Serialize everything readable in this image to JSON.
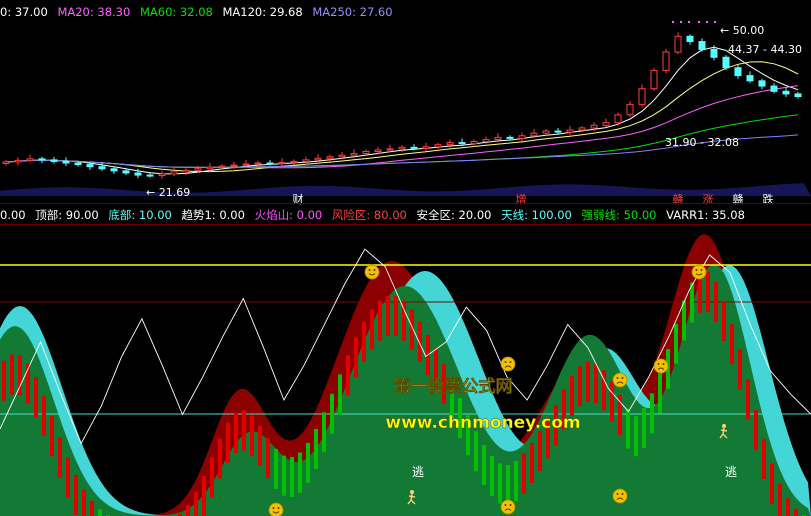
{
  "colors": {
    "bg": "#000000",
    "up_candle": "#ff3c3c",
    "down_candle": "#54ffff",
    "ma_white": "#ffffff",
    "ma20": "#ff60ff",
    "ma60": "#00e000",
    "ma120": "#e0e0e0",
    "ma250": "#8080ff",
    "volume_base": "#5050ff",
    "band_darkred": "#8b0000",
    "band_green": "#137a36",
    "band_cyan": "#44d6d6",
    "line_yellow": "#ffff00",
    "line_darkred": "#8b0000",
    "line_cyan": "#40e0d0",
    "bar_red": "#e00000",
    "bar_green": "#00c000",
    "watermark": "#ffff00"
  },
  "top_header": [
    {
      "text": "0: 37.00",
      "color": "#ffffff"
    },
    {
      "text": "MA20: 38.30",
      "color": "#ff60ff"
    },
    {
      "text": "MA60: 32.08",
      "color": "#00e000"
    },
    {
      "text": "MA120: 29.68",
      "color": "#ffffff"
    },
    {
      "text": "MA250: 27.60",
      "color": "#9090ff"
    }
  ],
  "indicator_header": [
    {
      "text": "0.00",
      "color": "#ffffff"
    },
    {
      "text": "顶部: 90.00",
      "color": "#ffffff"
    },
    {
      "text": "底部: 10.00",
      "color": "#54ffff"
    },
    {
      "text": "趋势1: 0.00",
      "color": "#ffffff"
    },
    {
      "text": "火焰山: 0.00",
      "color": "#ff50ff"
    },
    {
      "text": "风险区: 80.00",
      "color": "#ff4040"
    },
    {
      "text": "安全区: 20.00",
      "color": "#ffffff"
    },
    {
      "text": "天线: 100.00",
      "color": "#54ffff"
    },
    {
      "text": "强弱线: 50.00",
      "color": "#00e000"
    },
    {
      "text": "VARR1: 35.08",
      "color": "#ffffff"
    }
  ],
  "price_annotations": {
    "high": "50.00",
    "range": "44.37 - 44.30",
    "mid": "31.90 - 32.08",
    "low": "21.69"
  },
  "event_labels": [
    "财",
    "增",
    "赣",
    "涨",
    "赣",
    "跌"
  ],
  "signal_labels": [
    "逃",
    "逃"
  ],
  "watermark": {
    "title": "第一股票公式网",
    "url": "www.chnmoney.com"
  },
  "icons": [
    "smile-face-icon",
    "sad-face-icon",
    "runner-icon"
  ],
  "chart_data": [
    {
      "type": "candlestick",
      "title": "",
      "series": [
        {
          "name": "MA20",
          "value": 38.3
        },
        {
          "name": "MA60",
          "value": 32.08
        },
        {
          "name": "MA120",
          "value": 29.68
        },
        {
          "name": "MA250",
          "value": 27.6
        }
      ],
      "close": [
        24.5,
        24.8,
        25.1,
        24.9,
        24.6,
        24.3,
        24.0,
        23.6,
        23.2,
        22.8,
        22.4,
        22.0,
        21.9,
        22.2,
        22.6,
        22.9,
        23.2,
        23.5,
        23.7,
        23.9,
        24.1,
        24.3,
        24.2,
        24.4,
        24.6,
        24.9,
        25.2,
        25.5,
        25.8,
        26.1,
        26.5,
        26.8,
        27.0,
        27.3,
        27.1,
        27.4,
        27.8,
        28.2,
        28.0,
        28.4,
        28.8,
        29.2,
        29.0,
        29.5,
        30.0,
        30.4,
        30.2,
        30.6,
        31.0,
        31.5,
        32.0,
        33.5,
        35.5,
        38.5,
        42.0,
        45.5,
        48.5,
        47.5,
        46.0,
        44.5,
        42.5,
        41.0,
        40.0,
        39.0,
        38.0,
        37.5,
        37.0
      ],
      "ylim": [
        18,
        52
      ]
    },
    {
      "type": "line",
      "title": "",
      "ylim": [
        0,
        100
      ],
      "reference_lines": [
        90,
        80,
        20,
        10
      ],
      "series": [
        {
          "name": "VARR1",
          "values": [
            30,
            45,
            60,
            42,
            25,
            38,
            55,
            68,
            52,
            35,
            48,
            62,
            75,
            58,
            40,
            52,
            66,
            80,
            92,
            86,
            70,
            55,
            60,
            72,
            64,
            48,
            40,
            52,
            66,
            58,
            44,
            36,
            48,
            62,
            78,
            90,
            84,
            66,
            50,
            42,
            35.08
          ]
        }
      ]
    }
  ]
}
